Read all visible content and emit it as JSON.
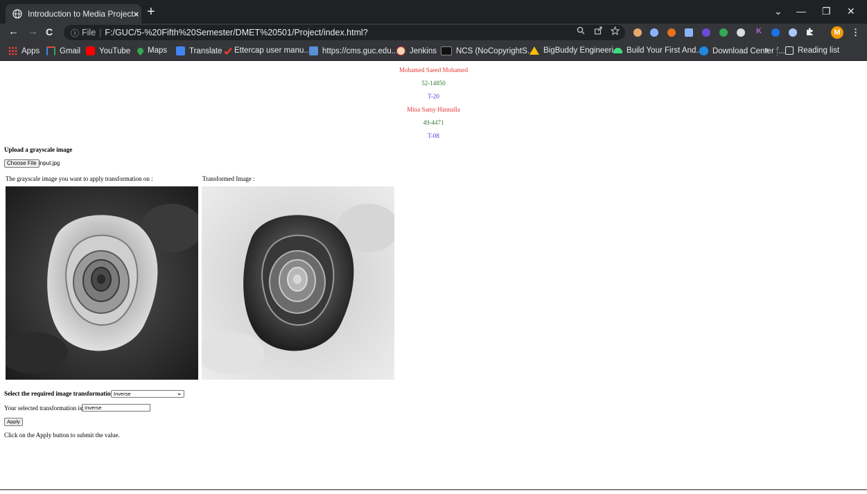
{
  "browser": {
    "tab_title": "Introduction to Media Project",
    "tab_close": "×",
    "new_tab": "+",
    "window_controls": {
      "chevron": "⌄",
      "minimize": "—",
      "restore": "❐",
      "close": "✕"
    },
    "nav": {
      "back": "←",
      "forward": "→",
      "reload": "C"
    },
    "address": {
      "info_icon": "ⓘ",
      "prefix": "File",
      "separator": "|",
      "path": "F:/GUC/5-%20Fifth%20Semester/DMET%20501/Project/index.html?"
    },
    "avatar_letter": "M",
    "menu": "⋮",
    "extension_letter_k": "K",
    "bookmarks": [
      {
        "label": "Apps",
        "color": "#ea4335"
      },
      {
        "label": "Gmail",
        "color": "#ea4335"
      },
      {
        "label": "YouTube",
        "color": "#ff0000"
      },
      {
        "label": "Maps",
        "color": "#34a853"
      },
      {
        "label": "Translate",
        "color": "#4285f4"
      },
      {
        "label": "Ettercap user manu...",
        "color": "#e53935"
      },
      {
        "label": "https://cms.guc.edu...",
        "color": "#5a8fd8"
      },
      {
        "label": "Jenkins",
        "color": "#d33833"
      },
      {
        "label": "NCS (NoCopyrightS...",
        "color": "#111111"
      },
      {
        "label": "BigBuddy Engineeri...",
        "color": "#fbbc05"
      },
      {
        "label": "Build Your First And...",
        "color": "#3ddc84"
      },
      {
        "label": "Download Center f...",
        "color": "#1e88e5"
      }
    ],
    "bookmarks_overflow": "»",
    "reading_list": "Reading list"
  },
  "page": {
    "people": [
      {
        "name": "Mohamed Saeed Mohamed",
        "id": "52-14850",
        "tutorial": "T-20"
      },
      {
        "name": "Mina Samy Hannalla",
        "id": "49-4471",
        "tutorial": "T-08"
      }
    ],
    "upload_title": "Upload a grayscale image",
    "choose_file_label": "Choose File",
    "file_name": "input.jpg",
    "original_caption": "The grayscale image you want to apply transformation on :",
    "transformed_caption": "Transformed Image :",
    "select_label": "Select the required image transformation",
    "selected_option": "Inverse",
    "your_selected_label": "Your selected transformation is:",
    "your_selected_value": "Inverse",
    "apply_label": "Apply",
    "hint": "Click on the Apply button to submit the value."
  },
  "colors": {
    "name_color": "#e43333",
    "id_color": "#2f7a2f",
    "tutorial_color": "#4040e0"
  }
}
